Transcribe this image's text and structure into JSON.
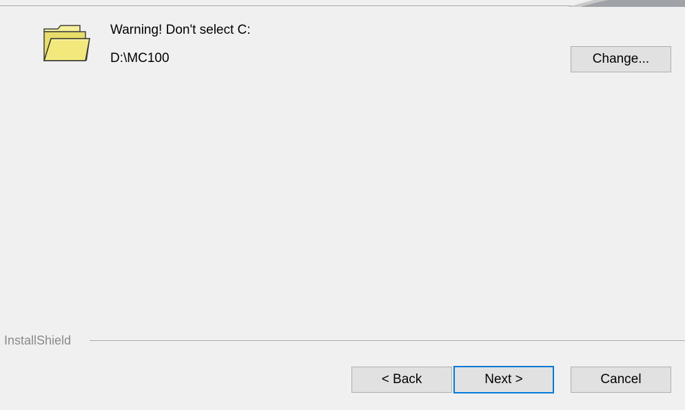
{
  "dialog": {
    "warning_text": "Warning!  Don't select C:",
    "install_path": "D:\\MC100",
    "change_label": "Change...",
    "folder_icon": "open-folder-icon"
  },
  "footer": {
    "brand": "InstallShield",
    "back_label": "< Back",
    "next_label": "Next >",
    "cancel_label": "Cancel"
  },
  "colors": {
    "background": "#f0f0f0",
    "button_face": "#e1e1e1",
    "button_border": "#adadad",
    "default_button_accent": "#0078d7",
    "folder_yellow": "#f2e87c"
  }
}
